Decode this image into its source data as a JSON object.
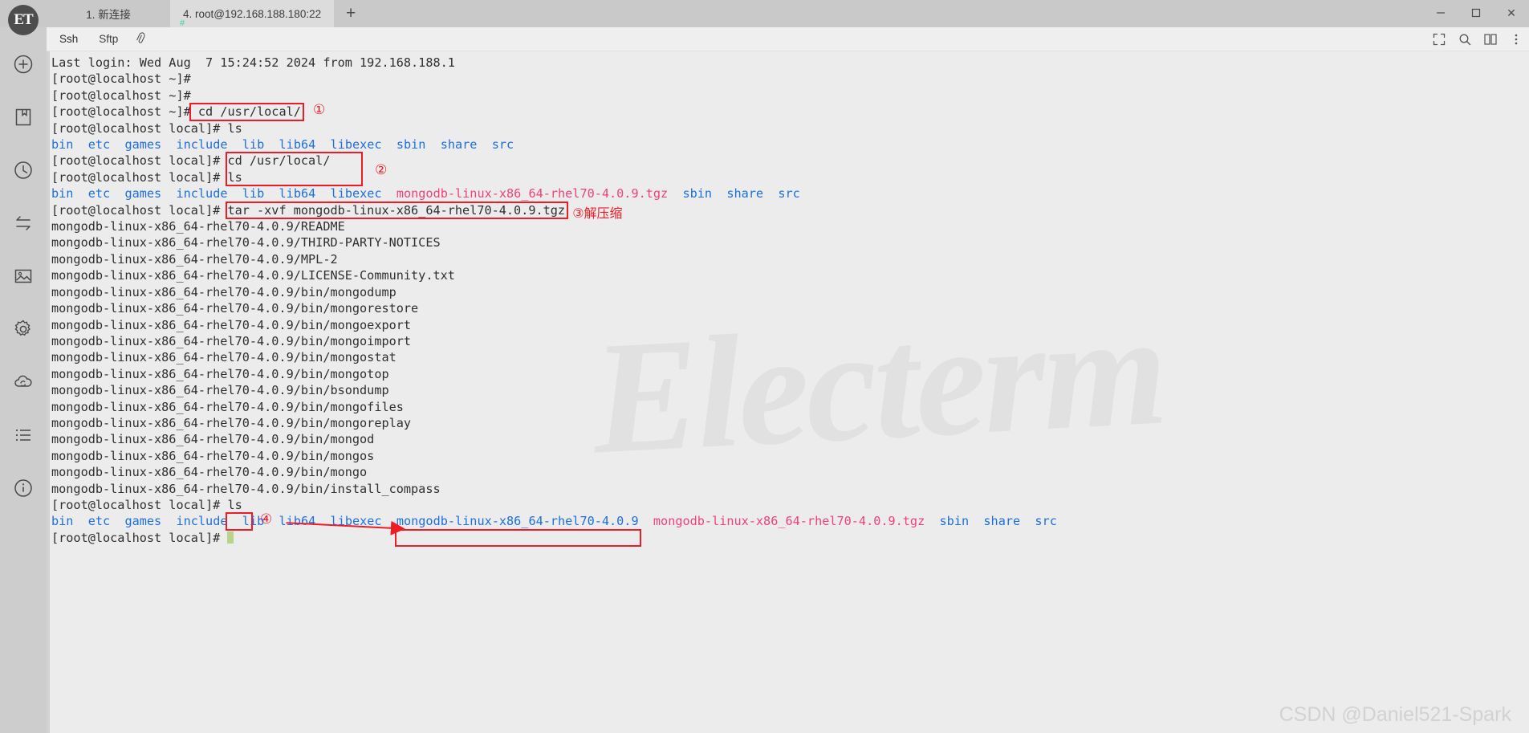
{
  "window": {
    "app_logo_text": "ET",
    "controls": {
      "minimize": "—",
      "maximize": "☐",
      "close": "✕"
    }
  },
  "tabs": [
    {
      "label": "1. 新连接",
      "sub": "",
      "active": false
    },
    {
      "label": "4. root@192.168.188.180:22",
      "sub": "#",
      "active": true
    }
  ],
  "tab_add_label": "+",
  "toolbar": {
    "ssh_label": "Ssh",
    "sftp_label": "Sftp",
    "attach_icon": "paperclip-icon",
    "fullscreen_icon": "fullscreen-icon",
    "search_icon": "search-icon",
    "layout_icon": "layout-grid-icon",
    "menu_icon": "menu-dots-icon"
  },
  "rail": [
    {
      "name": "add-connection",
      "icon": "plus-circle-icon"
    },
    {
      "name": "bookmarks",
      "icon": "bookmark-icon"
    },
    {
      "name": "history",
      "icon": "clock-icon"
    },
    {
      "name": "transfer",
      "icon": "transfer-arrows-icon"
    },
    {
      "name": "theme",
      "icon": "image-icon"
    },
    {
      "name": "settings",
      "icon": "gear-icon"
    },
    {
      "name": "sync",
      "icon": "cloud-sync-icon"
    },
    {
      "name": "batch-list",
      "icon": "list-icon"
    },
    {
      "name": "about",
      "icon": "info-circle-icon"
    }
  ],
  "watermark": "Electerm",
  "credit": "CSDN @Daniel521-Spark",
  "terminal": {
    "lines": [
      {
        "segments": [
          {
            "t": "Last login: Wed Aug  7 15:24:52 2024 from 192.168.188.1",
            "c": ""
          }
        ]
      },
      {
        "segments": [
          {
            "t": "[root@localhost ~]# ",
            "c": ""
          }
        ]
      },
      {
        "segments": [
          {
            "t": "[root@localhost ~]# ",
            "c": ""
          }
        ]
      },
      {
        "segments": [
          {
            "t": "[root@localhost ~]# cd /usr/local/",
            "c": ""
          }
        ]
      },
      {
        "segments": [
          {
            "t": "[root@localhost local]# ls",
            "c": ""
          }
        ]
      },
      {
        "segments": [
          {
            "t": "bin",
            "c": "c-blue"
          },
          {
            "t": "  ",
            "c": ""
          },
          {
            "t": "etc",
            "c": "c-blue"
          },
          {
            "t": "  ",
            "c": ""
          },
          {
            "t": "games",
            "c": "c-blue"
          },
          {
            "t": "  ",
            "c": ""
          },
          {
            "t": "include",
            "c": "c-blue"
          },
          {
            "t": "  ",
            "c": ""
          },
          {
            "t": "lib",
            "c": "c-blue"
          },
          {
            "t": "  ",
            "c": ""
          },
          {
            "t": "lib64",
            "c": "c-blue"
          },
          {
            "t": "  ",
            "c": ""
          },
          {
            "t": "libexec",
            "c": "c-blue"
          },
          {
            "t": "  ",
            "c": ""
          },
          {
            "t": "sbin",
            "c": "c-blue"
          },
          {
            "t": "  ",
            "c": ""
          },
          {
            "t": "share",
            "c": "c-blue"
          },
          {
            "t": "  ",
            "c": ""
          },
          {
            "t": "src",
            "c": "c-blue"
          }
        ]
      },
      {
        "segments": [
          {
            "t": "[root@localhost local]# cd /usr/local/",
            "c": ""
          }
        ]
      },
      {
        "segments": [
          {
            "t": "[root@localhost local]# ls",
            "c": ""
          }
        ]
      },
      {
        "segments": [
          {
            "t": "bin",
            "c": "c-blue"
          },
          {
            "t": "  ",
            "c": ""
          },
          {
            "t": "etc",
            "c": "c-blue"
          },
          {
            "t": "  ",
            "c": ""
          },
          {
            "t": "games",
            "c": "c-blue"
          },
          {
            "t": "  ",
            "c": ""
          },
          {
            "t": "include",
            "c": "c-blue"
          },
          {
            "t": "  ",
            "c": ""
          },
          {
            "t": "lib",
            "c": "c-blue"
          },
          {
            "t": "  ",
            "c": ""
          },
          {
            "t": "lib64",
            "c": "c-blue"
          },
          {
            "t": "  ",
            "c": ""
          },
          {
            "t": "libexec",
            "c": "c-blue"
          },
          {
            "t": "  ",
            "c": ""
          },
          {
            "t": "mongodb-linux-x86_64-rhel70-4.0.9.tgz",
            "c": "c-pink"
          },
          {
            "t": "  ",
            "c": ""
          },
          {
            "t": "sbin",
            "c": "c-blue"
          },
          {
            "t": "  ",
            "c": ""
          },
          {
            "t": "share",
            "c": "c-blue"
          },
          {
            "t": "  ",
            "c": ""
          },
          {
            "t": "src",
            "c": "c-blue"
          }
        ]
      },
      {
        "segments": [
          {
            "t": "[root@localhost local]# tar -xvf mongodb-linux-x86_64-rhel70-4.0.9.tgz",
            "c": ""
          }
        ]
      },
      {
        "segments": [
          {
            "t": "mongodb-linux-x86_64-rhel70-4.0.9/README",
            "c": ""
          }
        ]
      },
      {
        "segments": [
          {
            "t": "mongodb-linux-x86_64-rhel70-4.0.9/THIRD-PARTY-NOTICES",
            "c": ""
          }
        ]
      },
      {
        "segments": [
          {
            "t": "mongodb-linux-x86_64-rhel70-4.0.9/MPL-2",
            "c": ""
          }
        ]
      },
      {
        "segments": [
          {
            "t": "mongodb-linux-x86_64-rhel70-4.0.9/LICENSE-Community.txt",
            "c": ""
          }
        ]
      },
      {
        "segments": [
          {
            "t": "mongodb-linux-x86_64-rhel70-4.0.9/bin/mongodump",
            "c": ""
          }
        ]
      },
      {
        "segments": [
          {
            "t": "mongodb-linux-x86_64-rhel70-4.0.9/bin/mongorestore",
            "c": ""
          }
        ]
      },
      {
        "segments": [
          {
            "t": "mongodb-linux-x86_64-rhel70-4.0.9/bin/mongoexport",
            "c": ""
          }
        ]
      },
      {
        "segments": [
          {
            "t": "mongodb-linux-x86_64-rhel70-4.0.9/bin/mongoimport",
            "c": ""
          }
        ]
      },
      {
        "segments": [
          {
            "t": "mongodb-linux-x86_64-rhel70-4.0.9/bin/mongostat",
            "c": ""
          }
        ]
      },
      {
        "segments": [
          {
            "t": "mongodb-linux-x86_64-rhel70-4.0.9/bin/mongotop",
            "c": ""
          }
        ]
      },
      {
        "segments": [
          {
            "t": "mongodb-linux-x86_64-rhel70-4.0.9/bin/bsondump",
            "c": ""
          }
        ]
      },
      {
        "segments": [
          {
            "t": "mongodb-linux-x86_64-rhel70-4.0.9/bin/mongofiles",
            "c": ""
          }
        ]
      },
      {
        "segments": [
          {
            "t": "mongodb-linux-x86_64-rhel70-4.0.9/bin/mongoreplay",
            "c": ""
          }
        ]
      },
      {
        "segments": [
          {
            "t": "mongodb-linux-x86_64-rhel70-4.0.9/bin/mongod",
            "c": ""
          }
        ]
      },
      {
        "segments": [
          {
            "t": "mongodb-linux-x86_64-rhel70-4.0.9/bin/mongos",
            "c": ""
          }
        ]
      },
      {
        "segments": [
          {
            "t": "mongodb-linux-x86_64-rhel70-4.0.9/bin/mongo",
            "c": ""
          }
        ]
      },
      {
        "segments": [
          {
            "t": "mongodb-linux-x86_64-rhel70-4.0.9/bin/install_compass",
            "c": ""
          }
        ]
      },
      {
        "segments": [
          {
            "t": "[root@localhost local]# ls",
            "c": ""
          }
        ]
      },
      {
        "segments": [
          {
            "t": "bin",
            "c": "c-blue"
          },
          {
            "t": "  ",
            "c": ""
          },
          {
            "t": "etc",
            "c": "c-blue"
          },
          {
            "t": "  ",
            "c": ""
          },
          {
            "t": "games",
            "c": "c-blue"
          },
          {
            "t": "  ",
            "c": ""
          },
          {
            "t": "include",
            "c": "c-blue"
          },
          {
            "t": "  ",
            "c": ""
          },
          {
            "t": "lib",
            "c": "c-blue"
          },
          {
            "t": "  ",
            "c": ""
          },
          {
            "t": "lib64",
            "c": "c-blue"
          },
          {
            "t": "  ",
            "c": ""
          },
          {
            "t": "libexec",
            "c": "c-blue"
          },
          {
            "t": "  ",
            "c": ""
          },
          {
            "t": "mongodb-linux-x86_64-rhel70-4.0.9",
            "c": "c-blue"
          },
          {
            "t": "  ",
            "c": ""
          },
          {
            "t": "mongodb-linux-x86_64-rhel70-4.0.9.tgz",
            "c": "c-pink"
          },
          {
            "t": "  ",
            "c": ""
          },
          {
            "t": "sbin",
            "c": "c-blue"
          },
          {
            "t": "  ",
            "c": ""
          },
          {
            "t": "share",
            "c": "c-blue"
          },
          {
            "t": "  ",
            "c": ""
          },
          {
            "t": "src",
            "c": "c-blue"
          }
        ]
      },
      {
        "segments": [
          {
            "t": "[root@localhost local]# ",
            "c": ""
          }
        ],
        "cursor": true
      }
    ]
  },
  "annotations": {
    "color": "#ee1c25",
    "marks": [
      {
        "id": "1",
        "label": "①",
        "note": ""
      },
      {
        "id": "2",
        "label": "②",
        "note": ""
      },
      {
        "id": "3",
        "label": "③",
        "note": "解压缩"
      },
      {
        "id": "4",
        "label": "④",
        "note": ""
      }
    ]
  }
}
